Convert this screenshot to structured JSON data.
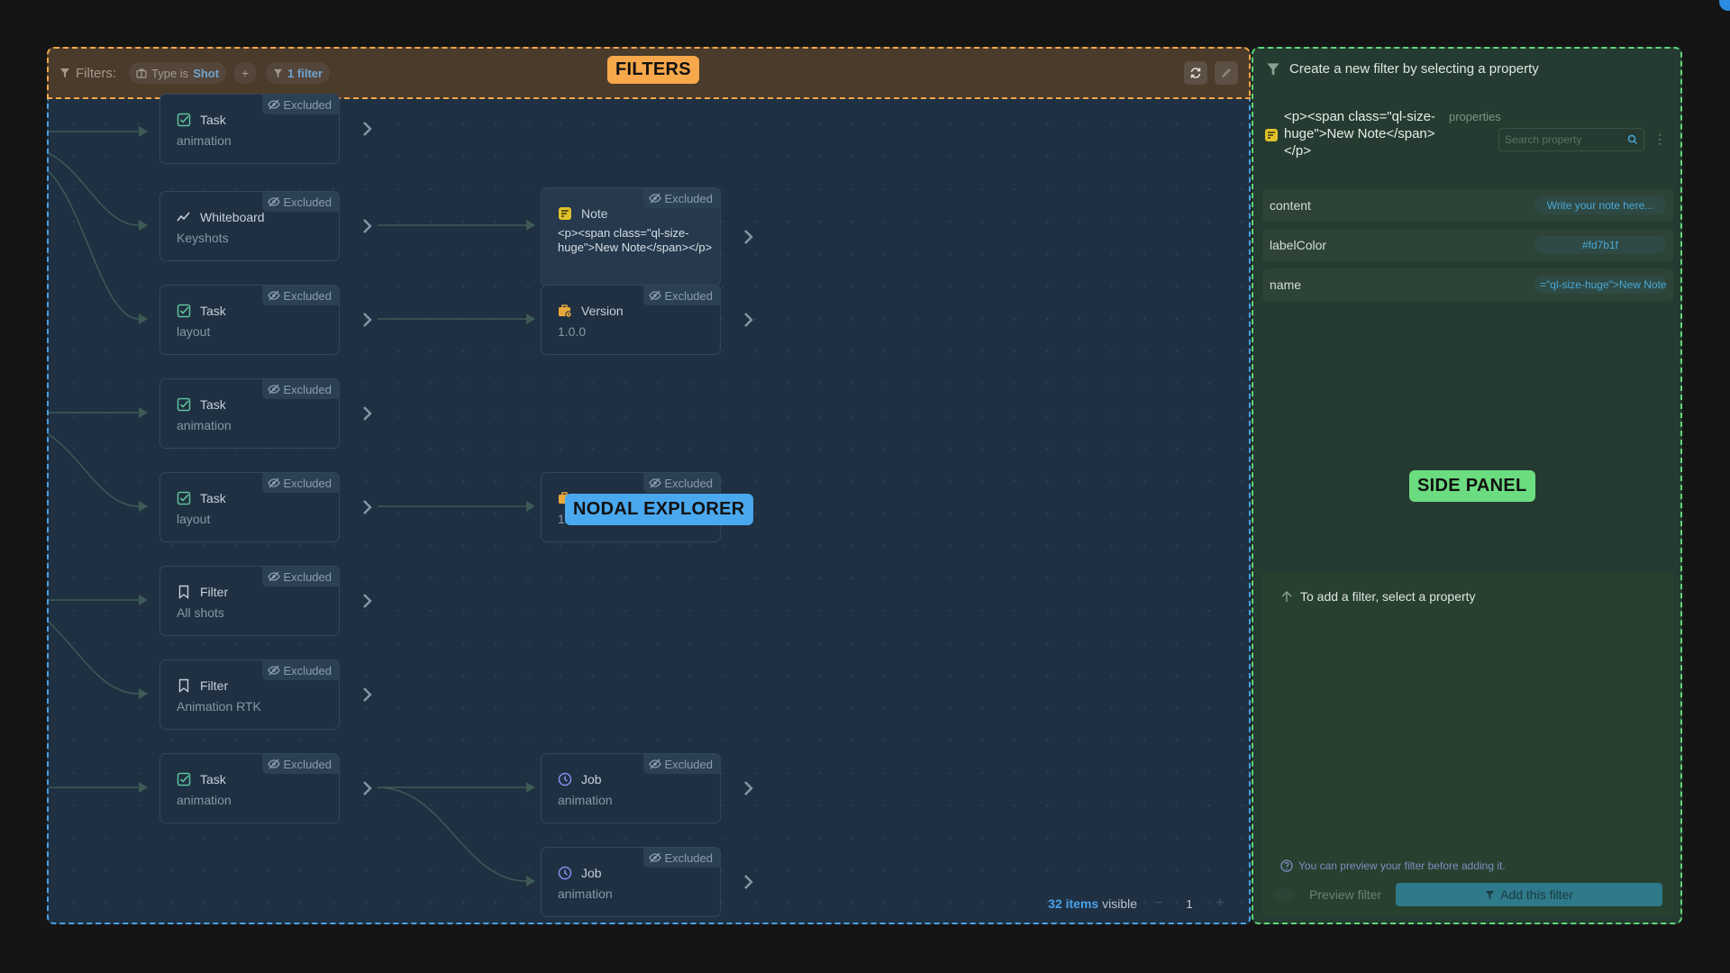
{
  "filters_bar": {
    "label": "Filters:",
    "chip_prefix": "Type is",
    "chip_value": "Shot",
    "add_label": "+",
    "count_label": "1 filter",
    "tag": "FILTERS"
  },
  "explorer": {
    "tag": "NODAL EXPLORER",
    "excluded_label": "Excluded",
    "nodes": [
      {
        "type": "Task",
        "sub": "animation",
        "icon": "task-check-icon"
      },
      {
        "type": "Whiteboard",
        "sub": "Keyshots",
        "icon": "whiteboard-chart-icon"
      },
      {
        "type": "Task",
        "sub": "layout",
        "icon": "task-check-icon"
      },
      {
        "type": "Task",
        "sub": "animation",
        "icon": "task-check-icon"
      },
      {
        "type": "Task",
        "sub": "layout",
        "icon": "task-check-icon"
      },
      {
        "type": "Filter",
        "sub": "All shots",
        "icon": "bookmark-icon"
      },
      {
        "type": "Filter",
        "sub": "Animation RTK",
        "icon": "bookmark-icon"
      },
      {
        "type": "Task",
        "sub": "animation",
        "icon": "task-check-icon"
      },
      {
        "type": "Note",
        "sub": "<p><span class=\"ql-size-huge\">New Note</span></p>",
        "icon": "note-icon"
      },
      {
        "type": "Version",
        "sub": "1.0.0",
        "icon": "version-briefcase-icon"
      },
      {
        "type": "Version",
        "sub": "1.0.0",
        "icon": "version-briefcase-icon"
      },
      {
        "type": "Job",
        "sub": "animation",
        "icon": "job-clock-icon"
      },
      {
        "type": "Job",
        "sub": "animation",
        "icon": "job-clock-icon"
      }
    ],
    "footer": {
      "count": "32 items",
      "suffix": "visible",
      "minus": "−",
      "page": "1",
      "plus": "+"
    }
  },
  "side_panel": {
    "title": "Create a new filter by selecting a property",
    "entity_title": "<p><span class=\"ql-size-huge\">New Note</span></p>",
    "properties_label": "properties",
    "search_placeholder": "Search property",
    "properties": [
      {
        "name": "content",
        "value": "Write your note here..."
      },
      {
        "name": "labelColor",
        "value": "#fd7b1f"
      },
      {
        "name": "name",
        "value": "=\"ql-size-huge\">New Note"
      }
    ],
    "tag": "SIDE PANEL",
    "hint": "To add a filter, select a property",
    "help": "You can preview your filter before adding it.",
    "preview_label": "Preview filter",
    "add_label": "Add this filter"
  },
  "colors": {
    "filters_accent": "#f7a84a",
    "explorer_accent": "#4aa8ef",
    "side_accent": "#6cdc80",
    "link_blue": "#4aa2e8",
    "note_yellow": "#e0c22a",
    "task_green": "#5fc29b",
    "version_orange": "#e6a93a",
    "job_purple": "#8a8cf0"
  }
}
